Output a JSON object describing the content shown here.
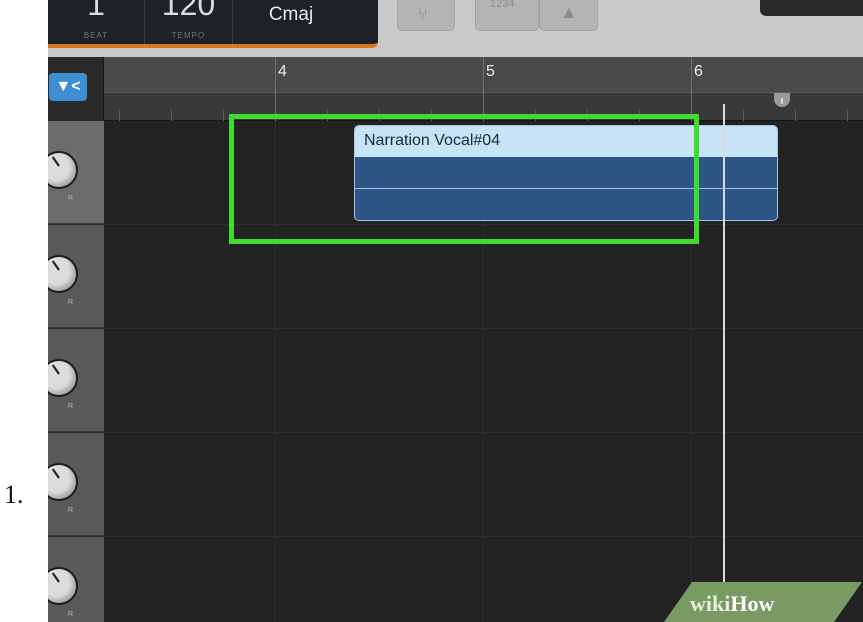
{
  "list_item": {
    "number": "1."
  },
  "lcd": {
    "beat": {
      "value": "1",
      "label": "BEAT"
    },
    "tempo": {
      "value": "120",
      "label": "TEMPO"
    },
    "key": "Cmaj"
  },
  "toolbar": {
    "tuner_icon": "tuner-fork-icon",
    "count_in_label": "1234",
    "metronome_icon": "metronome-icon"
  },
  "track_filter": {
    "icon": "filter-icon",
    "label": "▼<"
  },
  "ruler": {
    "bars": [
      "4",
      "5",
      "6"
    ]
  },
  "tracks": [
    {
      "knob_label": "R"
    },
    {
      "knob_label": "R"
    },
    {
      "knob_label": "R"
    },
    {
      "knob_label": "R"
    },
    {
      "knob_label": "R"
    }
  ],
  "region": {
    "name": "Narration Vocal#04",
    "color": "#2d5687",
    "header_color": "#c9e3f6"
  },
  "highlight": {
    "color": "#3ddc2f"
  },
  "watermark": {
    "part1": "wiki",
    "part2": "How"
  }
}
